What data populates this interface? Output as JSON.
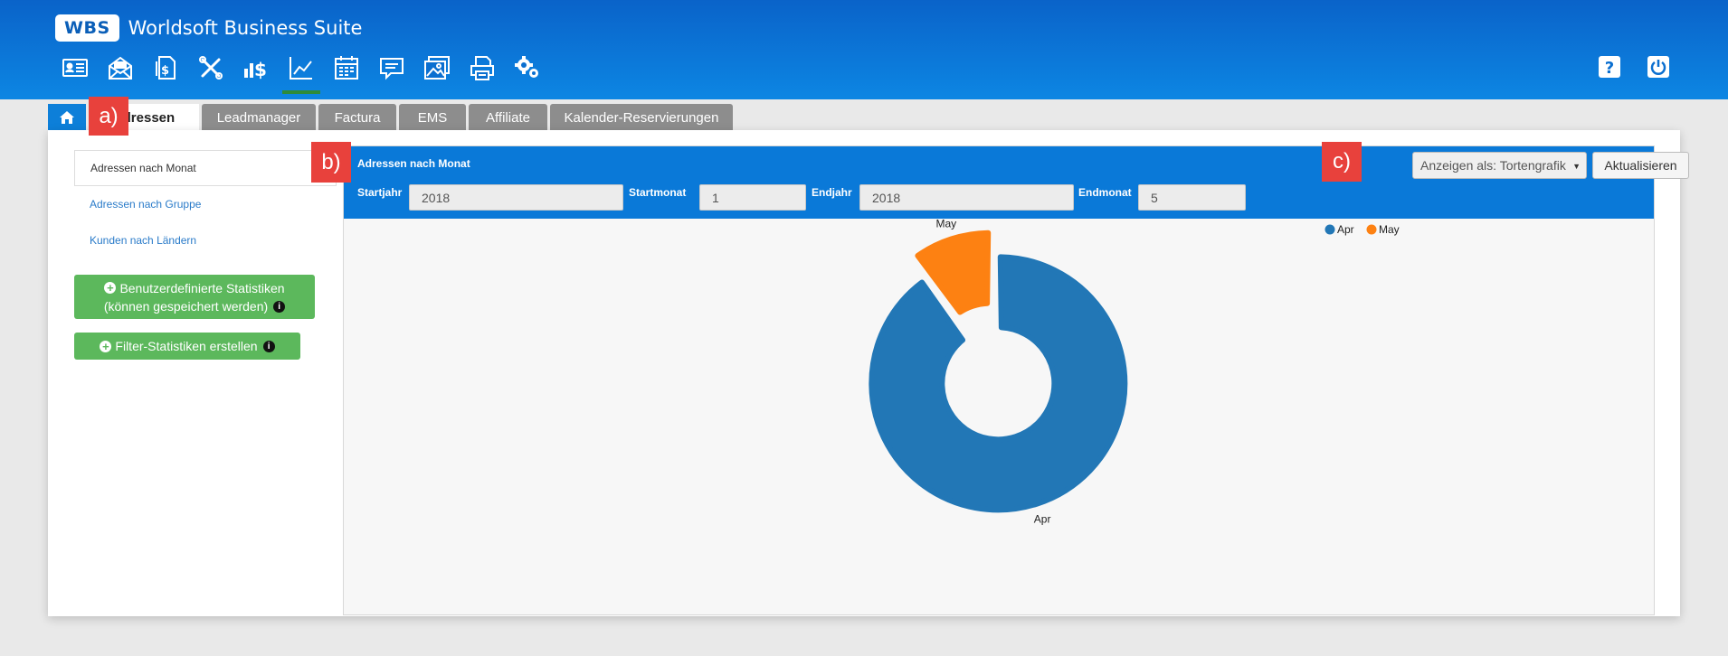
{
  "app": {
    "logo": "WBS",
    "title": "Worldsoft Business Suite"
  },
  "toolbar": {
    "icons": [
      "contact-card-icon",
      "newsletter-icon",
      "invoice-icon",
      "tools-icon",
      "sales-chart-icon",
      "statistics-icon",
      "calendar-icon",
      "comment-icon",
      "gallery-icon",
      "print-icon",
      "settings-gears-icon"
    ],
    "active": "statistics-icon"
  },
  "tabs": [
    {
      "label": "Adressen",
      "active": true
    },
    {
      "label": "Leadmanager"
    },
    {
      "label": "Factura"
    },
    {
      "label": "EMS"
    },
    {
      "label": "Affiliate"
    },
    {
      "label": "Kalender-Reservierungen"
    }
  ],
  "sidebar": {
    "items": [
      {
        "label": "Adressen nach Monat",
        "active": true
      },
      {
        "label": "Adressen nach Gruppe"
      },
      {
        "label": "Kunden nach Ländern"
      }
    ],
    "custom_stats_line1": "Benutzerdefinierte Statistiken",
    "custom_stats_line2": "(können gespeichert werden)",
    "filter_stats": "Filter-Statistiken erstellen"
  },
  "panel": {
    "title": "Adressen nach Monat",
    "startjahr_label": "Startjahr",
    "startjahr_value": "2018",
    "startmonat_label": "Startmonat",
    "startmonat_value": "1",
    "endjahr_label": "Endjahr",
    "endjahr_value": "2018",
    "endmonat_label": "Endmonat",
    "endmonat_value": "5",
    "display_select": "Anzeigen als: Tortengrafik",
    "refresh_label": "Aktualisieren"
  },
  "callouts": {
    "a": "a)",
    "b": "b)",
    "c": "c)"
  },
  "colors": {
    "header": "#0a63c9",
    "panel_head": "#0a79d8",
    "apr": "#2277b6",
    "may": "#fd8112",
    "green": "#5cb85c",
    "callout": "#e8413c"
  },
  "chart_data": {
    "type": "pie",
    "variant": "donut",
    "labels": [
      "Apr",
      "May"
    ],
    "values": [
      90,
      10
    ],
    "colors": [
      "#2277b6",
      "#fd8112"
    ],
    "legend": [
      "Apr",
      "May"
    ],
    "legend_position": "top-right"
  }
}
